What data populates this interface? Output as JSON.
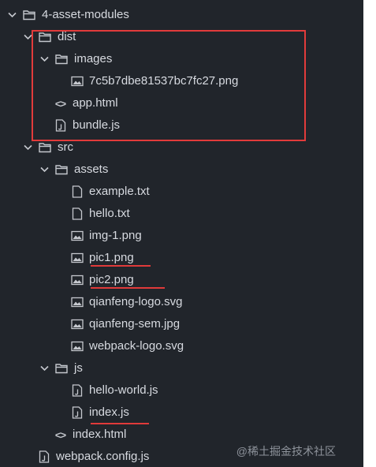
{
  "tree": [
    {
      "label": "4-asset-modules",
      "kind": "folder",
      "expanded": true
    },
    {
      "label": "dist",
      "kind": "folder",
      "expanded": true
    },
    {
      "label": "images",
      "kind": "folder",
      "expanded": true
    },
    {
      "label": "7c5b7dbe81537bc7fc27.png",
      "kind": "image"
    },
    {
      "label": "app.html",
      "kind": "html"
    },
    {
      "label": "bundle.js",
      "kind": "js"
    },
    {
      "label": "src",
      "kind": "folder",
      "expanded": true
    },
    {
      "label": "assets",
      "kind": "folder",
      "expanded": true
    },
    {
      "label": "example.txt",
      "kind": "text"
    },
    {
      "label": "hello.txt",
      "kind": "text"
    },
    {
      "label": "img-1.png",
      "kind": "image"
    },
    {
      "label": "pic1.png",
      "kind": "image"
    },
    {
      "label": "pic2.png",
      "kind": "image"
    },
    {
      "label": "qianfeng-logo.svg",
      "kind": "image"
    },
    {
      "label": "qianfeng-sem.jpg",
      "kind": "image"
    },
    {
      "label": "webpack-logo.svg",
      "kind": "image"
    },
    {
      "label": "js",
      "kind": "folder",
      "expanded": true
    },
    {
      "label": "hello-world.js",
      "kind": "js"
    },
    {
      "label": "index.js",
      "kind": "js"
    },
    {
      "label": "index.html",
      "kind": "html"
    },
    {
      "label": "webpack.config.js",
      "kind": "js"
    }
  ],
  "watermark": "@稀土掘金技术社区",
  "colors": {
    "panel_bg": "#21252b",
    "text": "#d7dae0",
    "icon": "#c5c8ce",
    "annotation_red": "#e23b3b"
  }
}
